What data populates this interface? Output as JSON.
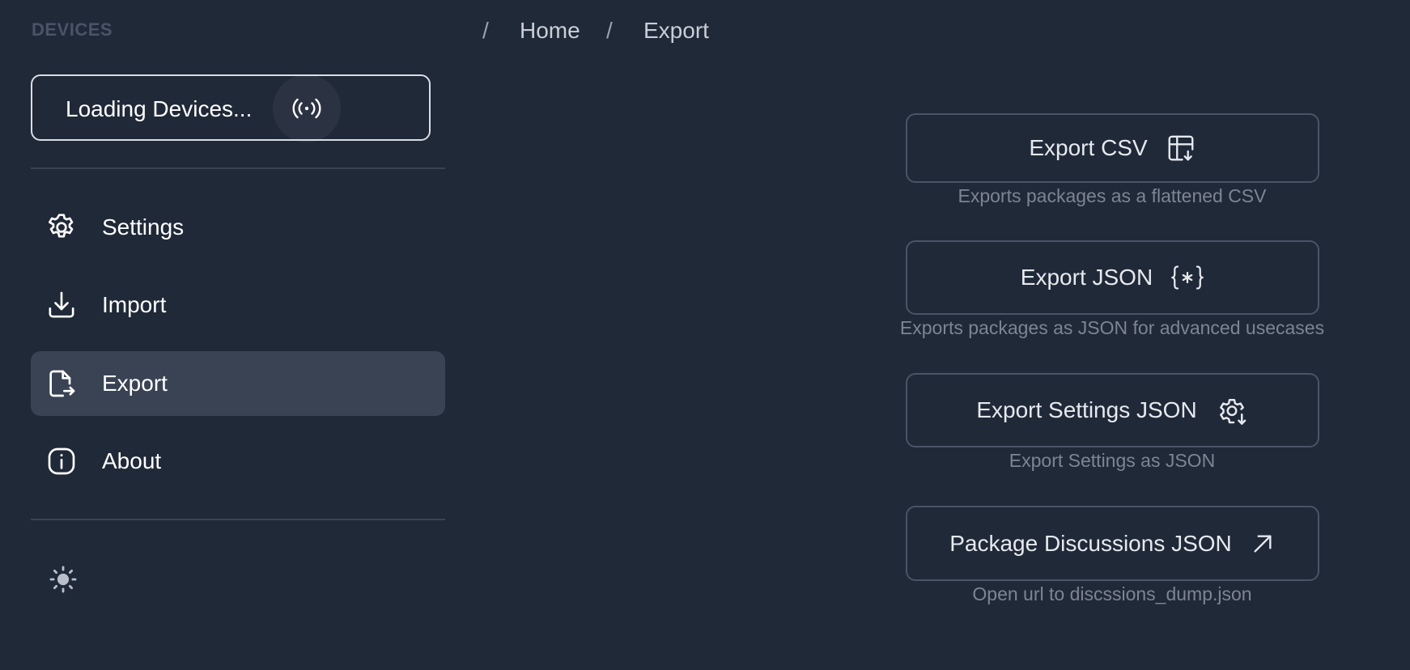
{
  "sidebar": {
    "section_title": "DEVICES",
    "device_button_label": "Loading Devices...",
    "items": [
      {
        "label": "Settings",
        "icon": "gear-icon"
      },
      {
        "label": "Import",
        "icon": "download-icon"
      },
      {
        "label": "Export",
        "icon": "file-export-icon",
        "active": true
      },
      {
        "label": "About",
        "icon": "info-icon"
      }
    ],
    "theme_icon": "sun-icon"
  },
  "breadcrumb": {
    "items": [
      "Home",
      "Export"
    ],
    "separator": "/"
  },
  "exports": [
    {
      "label": "Export CSV",
      "icon": "table-download-icon",
      "description": "Exports packages as a flattened CSV"
    },
    {
      "label": "Export JSON",
      "icon": "json-braces-icon",
      "description": "Exports packages as JSON for advanced usecases"
    },
    {
      "label": "Export Settings JSON",
      "icon": "gear-download-icon",
      "description": "Export Settings as JSON"
    },
    {
      "label": "Package Discussions JSON",
      "icon": "external-link-icon",
      "description": "Open url to discssions_dump.json"
    }
  ],
  "colors": {
    "background": "#202938",
    "active_item": "#394353",
    "border": "#4a5467",
    "muted_text": "#7d8594"
  }
}
